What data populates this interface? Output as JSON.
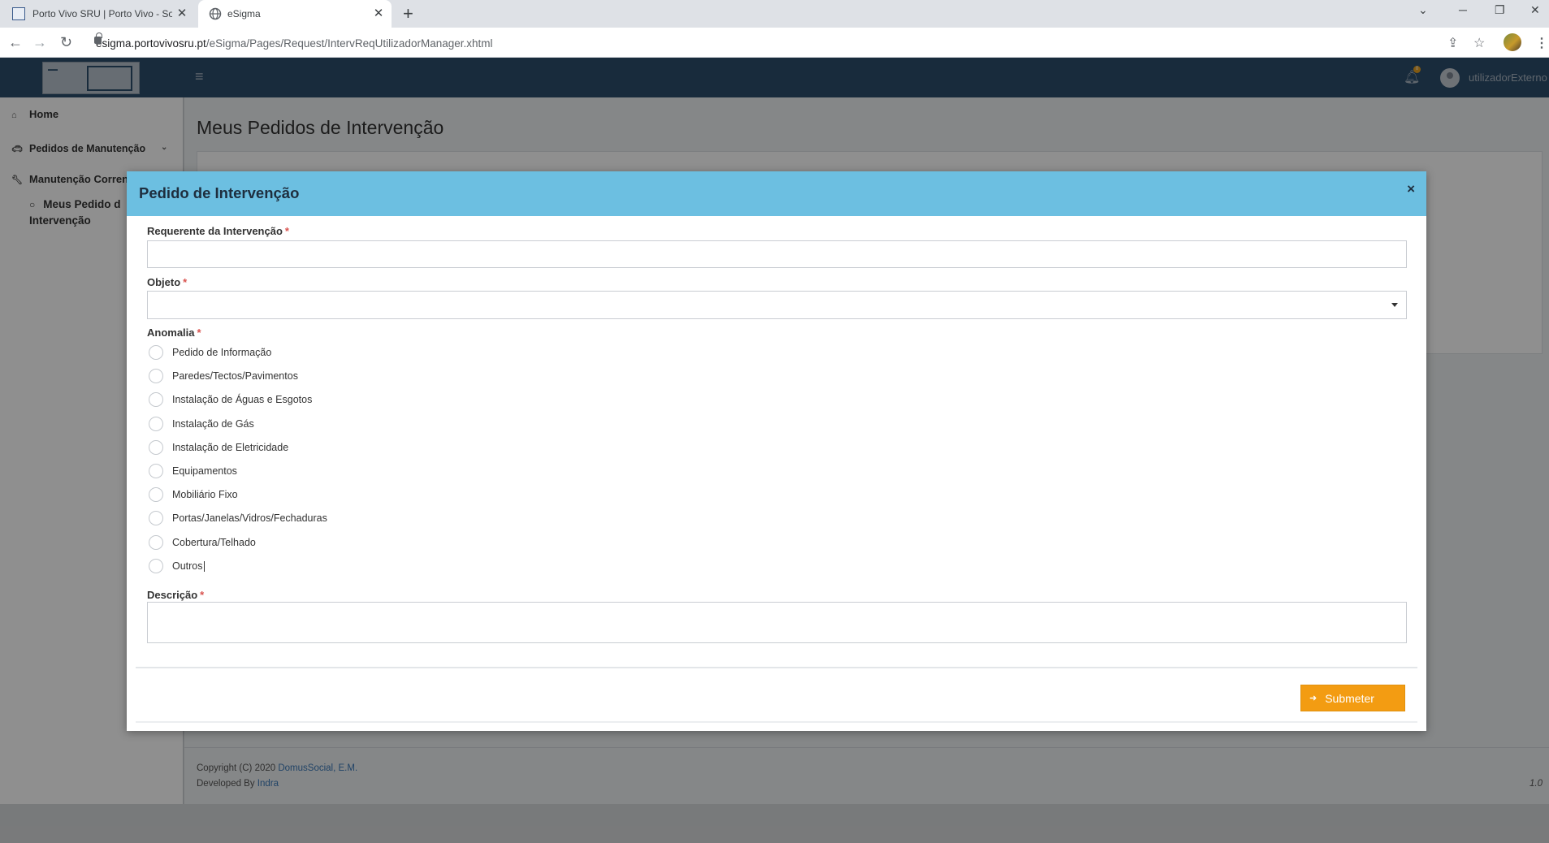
{
  "browser": {
    "tabs": [
      {
        "title": "Porto Vivo SRU | Porto Vivo - Soc",
        "active": false
      },
      {
        "title": "eSigma",
        "active": true
      }
    ],
    "url_host": "esigma.portovivosru.pt",
    "url_path": "/eSigma/Pages/Request/IntervReqUtilizadorManager.xhtml"
  },
  "header": {
    "username": "utilizadorExterno",
    "notification_count": "0"
  },
  "sidebar": {
    "items": [
      {
        "label": "Home",
        "icon": "home-icon"
      },
      {
        "label": "Pedidos de Manutenção",
        "icon": "car-icon"
      },
      {
        "label": "Manutenção Corren",
        "icon": "wrench-icon"
      }
    ],
    "sub_item_line1": "Meus Pedido d",
    "sub_item_line2": "Intervenção"
  },
  "page": {
    "title": "Meus Pedidos de Intervenção"
  },
  "modal": {
    "title": "Pedido de Intervenção",
    "close": "×",
    "requerente_label": "Requerente da Intervenção",
    "objeto_label": "Objeto",
    "anomalia_label": "Anomalia",
    "anomalias": [
      "Pedido de Informação",
      "Paredes/Tectos/Pavimentos",
      "Instalação de Águas e Esgotos",
      "Instalação de Gás",
      "Instalação de Eletricidade",
      "Equipamentos",
      "Mobiliário Fixo",
      "Portas/Janelas/Vidros/Fechaduras",
      "Cobertura/Telhado",
      "Outros"
    ],
    "descricao_label": "Descrição",
    "required_mark": "*",
    "submit_label": "Submeter"
  },
  "footer": {
    "copyright_prefix": "Copyright (C) 2020 ",
    "copyright_link": "DomusSocial, E.M.",
    "developed_prefix": "Developed By ",
    "developed_link": "Indra",
    "version": "1.0"
  },
  "colors": {
    "header_bg": "#2c4d6c",
    "modal_header": "#6cbfe1",
    "submit_bg": "#f39c12",
    "required": "#d9534f"
  }
}
